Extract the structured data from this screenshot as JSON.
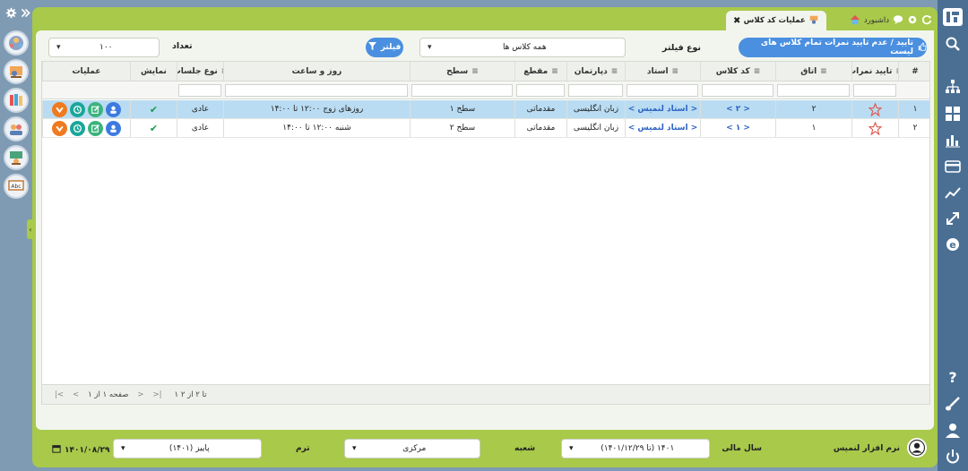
{
  "colors": {
    "accent_green": "#a8c94a",
    "nav_blue": "#4a6f93",
    "button_blue": "#4a8fe0",
    "row_selected": "#b9dcf2"
  },
  "tabs": {
    "active_label": "عملیات کد کلاس",
    "close_glyph": "✖",
    "dashboard_label": "داشبورد"
  },
  "toolbar": {
    "approve_all_label": "تایید / عدم تایید نمرات تمام کلاس های لیست",
    "filter_type_label": "نوع فیلتر",
    "filter_type_value": "همه کلاس ها",
    "filter_button_label": "فیلتر",
    "count_label": "تعداد",
    "count_value": "۱۰۰"
  },
  "grid": {
    "columns": {
      "index": "#",
      "approve": "تایید نمرات",
      "room": "اتاق",
      "class_code": "کد کلاس",
      "teacher": "استاد",
      "department": "دپارتمان",
      "segment": "مقطع",
      "level": "سطح",
      "schedule": "روز و ساعت",
      "session_type": "نوع جلسات",
      "display": "نمایش",
      "operations": "عملیات"
    },
    "rows": [
      {
        "index": "۱",
        "room": "۲",
        "class_code": "< ۲ >",
        "teacher": "< استاد لنمیس >",
        "department": "زبان انگلیسی",
        "segment": "مقدماتی",
        "level": "سطح ۱",
        "schedule": "روزهای زوج ۱۲:۰۰ تا ۱۴:۰۰",
        "session_type": "عادی",
        "display": "✔"
      },
      {
        "index": "۲",
        "room": "۱",
        "class_code": "< ۱ >",
        "teacher": "< استاد لنمیس >",
        "department": "زبان انگلیسی",
        "segment": "مقدماتی",
        "level": "سطح ۲",
        "schedule": "شنبه ۱۲:۰۰ تا ۱۴:۰۰",
        "session_type": "عادی",
        "display": "✔"
      }
    ],
    "footer": {
      "range_text": "۱ تا ۲ از ۲",
      "page_text": "صفحه ۱ از ۱"
    }
  },
  "bottom": {
    "software_name": "نرم افزار لنمیس",
    "fiscal_year_label": "سال مالی",
    "fiscal_year_value": "(تا ۱۴۰۱/۱۲/۲۹) ۱۴۰۱",
    "branch_label": "شعبه",
    "branch_value": "مرکزی",
    "term_label": "ترم",
    "term_value": "پاییز (۱۴۰۱)",
    "date_value": "۱۴۰۱/۰۸/۲۹"
  }
}
